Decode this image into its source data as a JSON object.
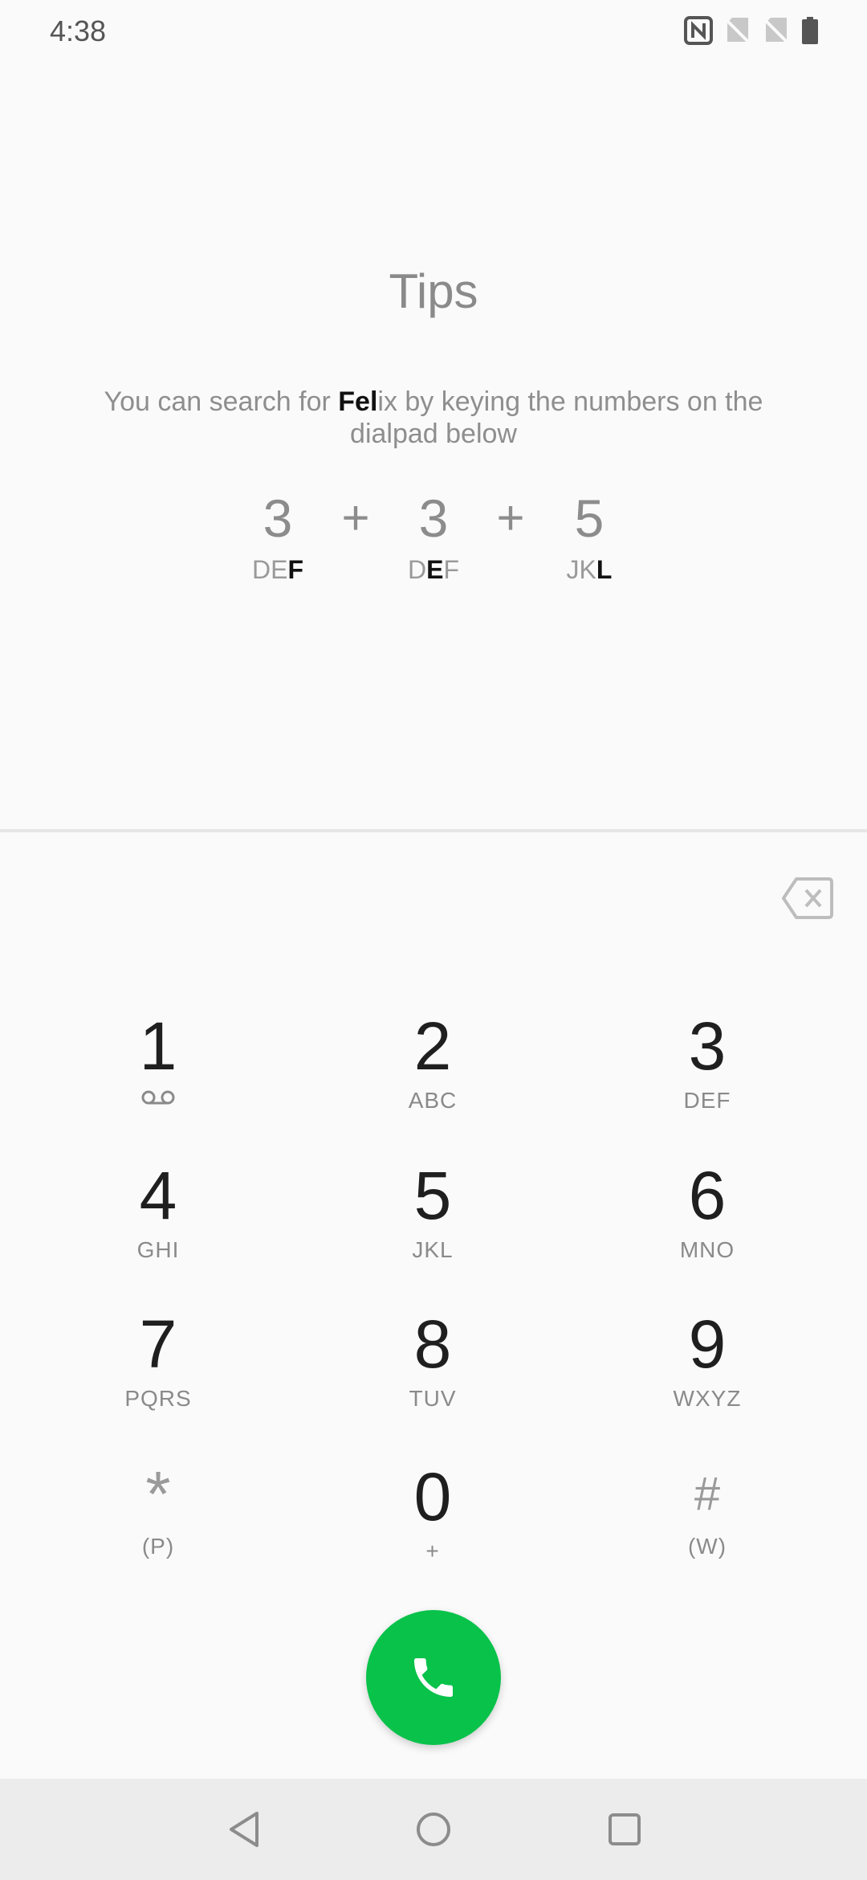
{
  "status_bar": {
    "time": "4:38",
    "icons": [
      "nfc-icon",
      "no-sim-icon",
      "no-sim-icon",
      "battery-icon"
    ]
  },
  "tips": {
    "title": "Tips",
    "text_before": "You can search for ",
    "text_bold": "Fel",
    "text_after": "ix by keying the numbers on the dialpad below",
    "example": [
      {
        "digit": "3",
        "letters_plain": "DE",
        "letters_bold": "F",
        "letters_after": ""
      },
      {
        "digit": "3",
        "letters_plain": "D",
        "letters_bold": "E",
        "letters_after": "F"
      },
      {
        "digit": "5",
        "letters_plain": "JK",
        "letters_bold": "L",
        "letters_after": ""
      }
    ],
    "plus": "+"
  },
  "dialpad": {
    "backspace_icon": "backspace-icon",
    "keys": [
      {
        "digit": "1",
        "letters": "",
        "icon": "voicemail-icon"
      },
      {
        "digit": "2",
        "letters": "ABC"
      },
      {
        "digit": "3",
        "letters": "DEF"
      },
      {
        "digit": "4",
        "letters": "GHI"
      },
      {
        "digit": "5",
        "letters": "JKL"
      },
      {
        "digit": "6",
        "letters": "MNO"
      },
      {
        "digit": "7",
        "letters": "PQRS"
      },
      {
        "digit": "8",
        "letters": "TUV"
      },
      {
        "digit": "9",
        "letters": "WXYZ"
      },
      {
        "digit": "*",
        "letters": "(P)"
      },
      {
        "digit": "0",
        "letters": "+"
      },
      {
        "digit": "#",
        "letters": "(W)"
      }
    ]
  },
  "call_button": {
    "icon": "phone-icon",
    "color": "#08c24a"
  },
  "nav_bar": {
    "buttons": [
      "back-icon",
      "home-icon",
      "recents-icon"
    ]
  }
}
